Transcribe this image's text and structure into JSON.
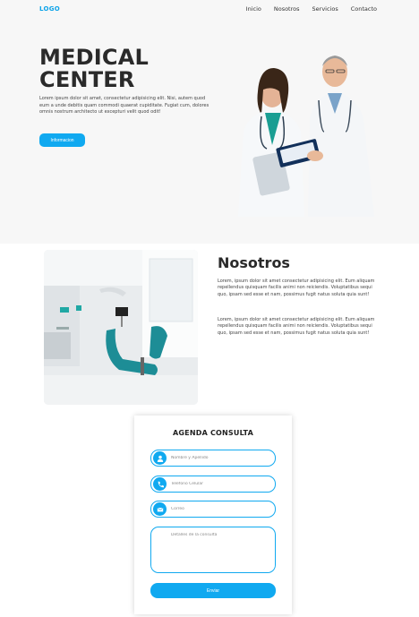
{
  "header": {
    "logo": "LOGO",
    "nav": [
      "Inicio",
      "Nosotros",
      "Servicios",
      "Contacto"
    ]
  },
  "hero": {
    "title": "MEDICAL CENTER",
    "text": "Lorem ipsum dolor sit amet, consectetur adipisicing elit. Nisi, autem quod eum a unde debitis quam commodi quaerat cupiditate. Fugiat cum, dolores omnis nostrum architecto ut excepturi velit quod odit!",
    "button": "Informacion"
  },
  "about": {
    "title": "Nosotros",
    "p1": "Lorem, ipsum dolor sit amet consectetur adipisicing elit. Eum aliquam repellendus quisquam facilis animi non reiciendis. Voluptatibus sequi quo, ipsam sed esse et nam, possimus fugit natus soluta quia sunt!",
    "p2": "Lorem, ipsum dolor sit amet consectetur adipisicing elit. Eum aliquam repellendus quisquam facilis animi non reiciendis. Voluptatibus sequi quo, ipsam sed esse et nam, possimus fugit natus soluta quia sunt!"
  },
  "form": {
    "title": "AGENDA CONSULTA",
    "name_placeholder": "Nombre y Apellido",
    "phone_placeholder": "Telefono Celular",
    "email_placeholder": "Correo",
    "details_placeholder": "Detalles de la consulta",
    "submit": "Enviar",
    "icons": [
      "user-icon",
      "phone-icon",
      "envelope-icon"
    ]
  },
  "colors": {
    "accent": "#10a9f0",
    "logo": "#0aa2e8",
    "hero_bg": "#f7f7f7",
    "heading": "#2a2a2a"
  }
}
